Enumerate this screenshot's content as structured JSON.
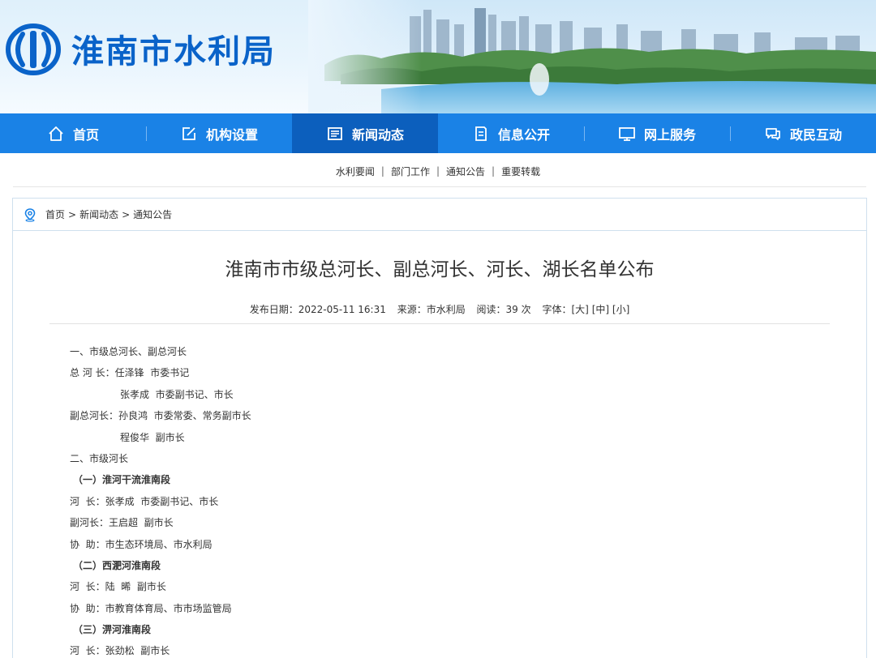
{
  "header": {
    "site_title": "淮南市水利局",
    "logo_icon": "water-bureau-logo-icon",
    "brand_color": "#0a63c9"
  },
  "nav": {
    "items": [
      {
        "label": "首页",
        "icon": "home-icon"
      },
      {
        "label": "机构设置",
        "icon": "edit-icon"
      },
      {
        "label": "新闻动态",
        "icon": "newspaper-icon",
        "active": true
      },
      {
        "label": "信息公开",
        "icon": "document-list-icon"
      },
      {
        "label": "网上服务",
        "icon": "monitor-icon"
      },
      {
        "label": "政民互动",
        "icon": "chat-icon"
      }
    ],
    "bg_color": "#1a82e6",
    "active_color": "#0c5fbd"
  },
  "subnav": {
    "items": [
      "水利要闻",
      "部门工作",
      "通知公告",
      "重要转载"
    ],
    "separator": "|"
  },
  "breadcrumb": {
    "items": [
      "首页",
      "新闻动态",
      "通知公告"
    ],
    "separator": ">"
  },
  "article": {
    "title": "淮南市市级总河长、副总河长、河长、湖长名单公布",
    "meta": {
      "date": "发布日期：2022-05-11 16:31",
      "source": "来源：市水利局",
      "reads": "阅读：39 次",
      "font_label": "字体：",
      "font_large": "[大]",
      "font_medium": "[中]",
      "font_small": "[小]"
    },
    "lines": [
      {
        "text": "一、市级总河长、副总河长",
        "style": "normal"
      },
      {
        "text": "总 河 长：任泽锋  市委书记",
        "style": "normal"
      },
      {
        "text": "张孝成  市委副书记、市长",
        "style": "indent"
      },
      {
        "text": "副总河长：孙良鸿  市委常委、常务副市长",
        "style": "normal"
      },
      {
        "text": "程俊华  副市长",
        "style": "indent"
      },
      {
        "text": "二、市级河长",
        "style": "normal"
      },
      {
        "text": "（一）淮河干流淮南段",
        "style": "bold"
      },
      {
        "text": "河  长：张孝成  市委副书记、市长",
        "style": "normal"
      },
      {
        "text": "副河长：王启超  副市长",
        "style": "normal"
      },
      {
        "text": "协  助：市生态环境局、市水利局",
        "style": "normal"
      },
      {
        "text": "（二）西淝河淮南段",
        "style": "bold"
      },
      {
        "text": "河  长：陆  晞  副市长",
        "style": "normal"
      },
      {
        "text": "协  助：市教育体育局、市市场监管局",
        "style": "normal"
      },
      {
        "text": "（三）淠河淮南段",
        "style": "bold"
      },
      {
        "text": "河  长：张劲松  副市长",
        "style": "normal"
      }
    ]
  }
}
